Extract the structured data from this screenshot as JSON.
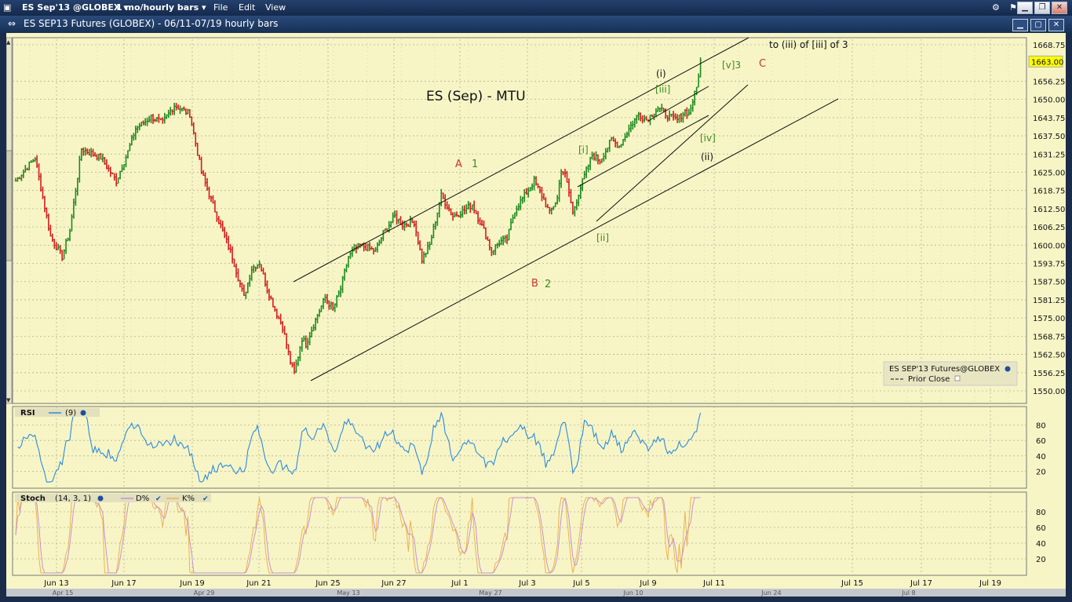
{
  "menu": {
    "symbol": "ES Sep'13 @GLOBEX",
    "interval": "1 mo/hourly bars",
    "file": "File",
    "edit": "Edit",
    "view": "View"
  },
  "window": {
    "title": "ES SEP13 Futures (GLOBEX) - 06/11-07/19 hourly bars"
  },
  "chart_data": {
    "type": "ohlc",
    "title": "ES (Sep) - MTU",
    "price_axis": {
      "min": 1550,
      "max": 1668.75,
      "ticks": [
        1668.75,
        1656.25,
        1650.0,
        1643.75,
        1637.5,
        1631.25,
        1625.0,
        1618.75,
        1612.5,
        1606.25,
        1600.0,
        1593.75,
        1587.5,
        1581.25,
        1575.0,
        1568.75,
        1562.5,
        1556.25,
        1550.0
      ],
      "last_price": "1663.00"
    },
    "x_axis": {
      "ticks": [
        "Jun 13",
        "Jun 17",
        "Jun 19",
        "Jun 21",
        "Jun 25",
        "Jun 27",
        "Jul 1",
        "Jul 3",
        "Jul 5",
        "Jul 9",
        "Jul 11",
        "Jul 15",
        "Jul 17",
        "Jul 19"
      ],
      "secondary_ticks": [
        "Apr 15",
        "Apr 29",
        "May 13",
        "May 27",
        "Jun 10",
        "Jun 24",
        "Jul 8"
      ]
    },
    "key_points": [
      [
        0,
        1622
      ],
      [
        10,
        1630
      ],
      [
        18,
        1603
      ],
      [
        24,
        1596
      ],
      [
        28,
        1605
      ],
      [
        34,
        1633
      ],
      [
        44,
        1630
      ],
      [
        52,
        1622
      ],
      [
        58,
        1632
      ],
      [
        62,
        1640
      ],
      [
        70,
        1644
      ],
      [
        76,
        1642
      ],
      [
        82,
        1648
      ],
      [
        90,
        1645
      ],
      [
        96,
        1625
      ],
      [
        104,
        1610
      ],
      [
        112,
        1596
      ],
      [
        118,
        1582
      ],
      [
        122,
        1592
      ],
      [
        126,
        1594
      ],
      [
        130,
        1585
      ],
      [
        134,
        1578
      ],
      [
        138,
        1572
      ],
      [
        142,
        1560
      ],
      [
        144,
        1556
      ],
      [
        148,
        1568
      ],
      [
        150,
        1566
      ],
      [
        156,
        1576
      ],
      [
        160,
        1582
      ],
      [
        164,
        1578
      ],
      [
        168,
        1585
      ],
      [
        172,
        1596
      ],
      [
        178,
        1600
      ],
      [
        186,
        1598
      ],
      [
        190,
        1604
      ],
      [
        196,
        1610
      ],
      [
        200,
        1607
      ],
      [
        206,
        1608
      ],
      [
        210,
        1595
      ],
      [
        214,
        1600
      ],
      [
        220,
        1617
      ],
      [
        226,
        1610
      ],
      [
        232,
        1612
      ],
      [
        236,
        1614
      ],
      [
        242,
        1605
      ],
      [
        246,
        1598
      ],
      [
        250,
        1601
      ],
      [
        254,
        1602
      ],
      [
        258,
        1612
      ],
      [
        264,
        1618
      ],
      [
        268,
        1622
      ],
      [
        272,
        1617
      ],
      [
        274,
        1614
      ],
      [
        276,
        1611
      ],
      [
        280,
        1616
      ],
      [
        282,
        1626
      ],
      [
        284,
        1624
      ],
      [
        286,
        1618
      ],
      [
        288,
        1611
      ],
      [
        292,
        1620
      ],
      [
        298,
        1631
      ],
      [
        302,
        1629
      ],
      [
        308,
        1636
      ],
      [
        312,
        1634
      ],
      [
        318,
        1641
      ],
      [
        322,
        1645
      ],
      [
        326,
        1643
      ],
      [
        332,
        1647
      ],
      [
        338,
        1644
      ],
      [
        342,
        1643
      ],
      [
        346,
        1646
      ],
      [
        348,
        1645
      ],
      [
        352,
        1654
      ],
      [
        354,
        1663
      ]
    ],
    "legend": {
      "instrument": "ES SEP'13 Futures@GLOBEX",
      "prior_close": "Prior Close"
    },
    "annotations": {
      "A": "A",
      "one": "1",
      "B": "B",
      "two": "2",
      "C": "C",
      "i_minute": "(i)",
      "iii_sub": "[iii]",
      "i_sub": "[i]",
      "ii_sub": "[ii]",
      "iv_sub": "[iv]",
      "ii_minute": "(ii)",
      "v3": "[v]3",
      "target": "to (iii) of [iii] of 3"
    },
    "rsi": {
      "label": "RSI",
      "param": "(9)",
      "ticks": [
        "80",
        "60",
        "40",
        "20"
      ],
      "range": [
        0,
        100
      ]
    },
    "stoch": {
      "label": "Stoch",
      "params": "(14, 3, 1)",
      "d_label": "D%",
      "k_label": "K%",
      "ticks": [
        "80",
        "60",
        "40",
        "20"
      ],
      "range": [
        0,
        100
      ]
    },
    "colors": {
      "background": "#f7f5c6",
      "up_bar": "#1e8a1e",
      "down_bar": "#d21d1d",
      "rsi_line": "#2b8be0",
      "stoch_d": "#c592d6",
      "stoch_k": "#f0b24d",
      "last_price_box": "#ffff00",
      "wave_green": "#3b8a1e",
      "wave_red": "#cc3333"
    }
  }
}
